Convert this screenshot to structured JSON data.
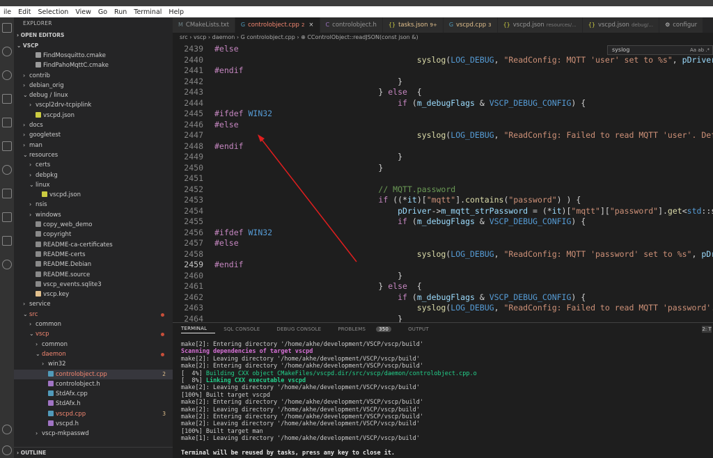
{
  "menu": [
    "ile",
    "Edit",
    "Selection",
    "View",
    "Go",
    "Run",
    "Terminal",
    "Help"
  ],
  "sidebar": {
    "title": "EXPLORER",
    "open_editors": "OPEN EDITORS",
    "root": "VSCP",
    "outline": "OUTLINE",
    "items": [
      {
        "label": "FindMosquitto.cmake",
        "indent": 2,
        "icon": "cmake-file-icon",
        "chev": ""
      },
      {
        "label": "FindPahoMqttC.cmake",
        "indent": 2,
        "icon": "cmake-file-icon",
        "chev": ""
      },
      {
        "label": "contrib",
        "indent": 1,
        "chev": "›"
      },
      {
        "label": "debian_orig",
        "indent": 1,
        "chev": "›"
      },
      {
        "label": "debug / linux",
        "indent": 1,
        "chev": "⌄"
      },
      {
        "label": "vscpl2drv-tcpiplink",
        "indent": 2,
        "chev": "›"
      },
      {
        "label": "vscpd.json",
        "indent": 2,
        "icon": "json-file-icon",
        "chev": ""
      },
      {
        "label": "docs",
        "indent": 1,
        "chev": "›"
      },
      {
        "label": "googletest",
        "indent": 1,
        "chev": "›"
      },
      {
        "label": "man",
        "indent": 1,
        "chev": "›"
      },
      {
        "label": "resources",
        "indent": 1,
        "chev": "⌄"
      },
      {
        "label": "certs",
        "indent": 2,
        "chev": "›"
      },
      {
        "label": "debpkg",
        "indent": 2,
        "chev": "›"
      },
      {
        "label": "linux",
        "indent": 2,
        "chev": "⌄"
      },
      {
        "label": "vscpd.json",
        "indent": 3,
        "icon": "json-file-icon",
        "chev": ""
      },
      {
        "label": "nsis",
        "indent": 2,
        "chev": "›"
      },
      {
        "label": "windows",
        "indent": 2,
        "chev": "›"
      },
      {
        "label": "copy_web_demo",
        "indent": 2,
        "icon": "file-icon",
        "chev": ""
      },
      {
        "label": "copyright",
        "indent": 2,
        "icon": "file-icon",
        "chev": ""
      },
      {
        "label": "README-ca-certificates",
        "indent": 2,
        "icon": "file-icon",
        "chev": ""
      },
      {
        "label": "README-certs",
        "indent": 2,
        "icon": "file-icon",
        "chev": ""
      },
      {
        "label": "README.Debian",
        "indent": 2,
        "icon": "file-icon",
        "chev": ""
      },
      {
        "label": "README.source",
        "indent": 2,
        "icon": "file-icon",
        "chev": ""
      },
      {
        "label": "vscp_events.sqlite3",
        "indent": 2,
        "icon": "file-icon",
        "chev": ""
      },
      {
        "label": "vscp.key",
        "indent": 2,
        "icon": "key-file-icon",
        "chev": ""
      },
      {
        "label": "service",
        "indent": 1,
        "chev": "›"
      },
      {
        "label": "src",
        "indent": 1,
        "chev": "⌄",
        "cls": "err",
        "dot": true
      },
      {
        "label": "common",
        "indent": 2,
        "chev": "›"
      },
      {
        "label": "vscp",
        "indent": 2,
        "chev": "⌄",
        "cls": "err",
        "dot": true
      },
      {
        "label": "common",
        "indent": 3,
        "chev": "›"
      },
      {
        "label": "daemon",
        "indent": 3,
        "chev": "⌄",
        "cls": "err",
        "dot": true
      },
      {
        "label": "win32",
        "indent": 4,
        "chev": "›"
      },
      {
        "label": "controlobject.cpp",
        "indent": 4,
        "icon": "cpp-file-icon",
        "chev": "",
        "cls": "err",
        "badge": "2",
        "active": true
      },
      {
        "label": "controlobject.h",
        "indent": 4,
        "icon": "c-header-file-icon",
        "chev": ""
      },
      {
        "label": "StdAfx.cpp",
        "indent": 4,
        "icon": "cpp-file-icon",
        "chev": ""
      },
      {
        "label": "StdAfx.h",
        "indent": 4,
        "icon": "c-header-file-icon",
        "chev": ""
      },
      {
        "label": "vscpd.cpp",
        "indent": 4,
        "icon": "cpp-file-icon",
        "chev": "",
        "cls": "err",
        "badge": "3"
      },
      {
        "label": "vscpd.h",
        "indent": 4,
        "icon": "c-header-file-icon",
        "chev": ""
      },
      {
        "label": "vscp-mkpasswd",
        "indent": 3,
        "chev": "›"
      }
    ]
  },
  "tabs": [
    {
      "label": "CMakeLists.txt",
      "icon": "M",
      "badge": ""
    },
    {
      "label": "controlobject.cpp",
      "icon": "G",
      "badge": "2",
      "active": true,
      "close": "×"
    },
    {
      "label": "controlobject.h",
      "icon": "C",
      "badge": ""
    },
    {
      "label": "tasks.json",
      "icon": "{}",
      "badge": "9+"
    },
    {
      "label": "vscpd.cpp",
      "icon": "G",
      "badge": "3"
    },
    {
      "label": "vscpd.json",
      "icon": "{}",
      "sub": "resources/..."
    },
    {
      "label": "vscpd.json",
      "icon": "{}",
      "sub": "debug/..."
    },
    {
      "label": "configur",
      "icon": "⚙",
      "sub": ""
    }
  ],
  "breadcrumb": "src  ›  vscp  ›  daemon  ›  G controlobject.cpp  ›  ⊕ CControlObject::readJSON(const json &)",
  "find": {
    "query": "syslog",
    "options": "Aa ab .*"
  },
  "editor": {
    "current_line": "2459",
    "lines": [
      {
        "n": "2439",
        "segs": [
          {
            "t": "#else",
            "c": "pp"
          }
        ]
      },
      {
        "n": "2440",
        "segs": [
          {
            "t": "                                          "
          },
          {
            "t": "syslog",
            "c": "fn"
          },
          {
            "t": "("
          },
          {
            "t": "LOG_DEBUG",
            "c": "mac"
          },
          {
            "t": ", "
          },
          {
            "t": "\"ReadConfig: MQTT 'user' set to %s\"",
            "c": "str"
          },
          {
            "t": ", "
          },
          {
            "t": "pDriver",
            "c": "var"
          }
        ]
      },
      {
        "n": "2441",
        "segs": [
          {
            "t": "#endif",
            "c": "pp"
          }
        ]
      },
      {
        "n": "2442",
        "segs": [
          {
            "t": "                                      }"
          }
        ]
      },
      {
        "n": "2443",
        "segs": [
          {
            "t": "                                  } "
          },
          {
            "t": "else",
            "c": "kw"
          },
          {
            "t": "  {"
          }
        ]
      },
      {
        "n": "2444",
        "segs": [
          {
            "t": "                                      "
          },
          {
            "t": "if",
            "c": "kw"
          },
          {
            "t": " ("
          },
          {
            "t": "m_debugFlags",
            "c": "var"
          },
          {
            "t": " & "
          },
          {
            "t": "VSCP_DEBUG_CONFIG",
            "c": "mac"
          },
          {
            "t": ") {"
          }
        ]
      },
      {
        "n": "2445",
        "segs": [
          {
            "t": "#ifdef ",
            "c": "pp"
          },
          {
            "t": "WIN32",
            "c": "mac"
          }
        ]
      },
      {
        "n": "2446",
        "segs": [
          {
            "t": "#else",
            "c": "pp"
          }
        ]
      },
      {
        "n": "2447",
        "segs": [
          {
            "t": "                                          "
          },
          {
            "t": "syslog",
            "c": "fn"
          },
          {
            "t": "("
          },
          {
            "t": "LOG_DEBUG",
            "c": "mac"
          },
          {
            "t": ", "
          },
          {
            "t": "\"ReadConfig: Failed to read MQTT 'user'. Def",
            "c": "str"
          }
        ]
      },
      {
        "n": "2448",
        "segs": [
          {
            "t": "#endif",
            "c": "pp"
          }
        ]
      },
      {
        "n": "2449",
        "segs": [
          {
            "t": "                                      }"
          }
        ]
      },
      {
        "n": "2450",
        "segs": [
          {
            "t": "                                  }"
          }
        ]
      },
      {
        "n": "2451",
        "segs": [
          {
            "t": ""
          }
        ]
      },
      {
        "n": "2452",
        "segs": [
          {
            "t": "                                  "
          },
          {
            "t": "// MQTT.password",
            "c": "cmt"
          }
        ]
      },
      {
        "n": "2453",
        "segs": [
          {
            "t": "                                  "
          },
          {
            "t": "if",
            "c": "kw"
          },
          {
            "t": " ((*"
          },
          {
            "t": "it",
            "c": "var"
          },
          {
            "t": ")["
          },
          {
            "t": "\"mqtt\"",
            "c": "str"
          },
          {
            "t": "]."
          },
          {
            "t": "contains",
            "c": "fn"
          },
          {
            "t": "("
          },
          {
            "t": "\"password\"",
            "c": "str"
          },
          {
            "t": ") ) {"
          }
        ]
      },
      {
        "n": "2454",
        "segs": [
          {
            "t": "                                      "
          },
          {
            "t": "pDriver",
            "c": "var"
          },
          {
            "t": "->"
          },
          {
            "t": "m_mqtt_strPassword",
            "c": "var"
          },
          {
            "t": " = (*"
          },
          {
            "t": "it",
            "c": "var"
          },
          {
            "t": ")["
          },
          {
            "t": "\"mqtt\"",
            "c": "str"
          },
          {
            "t": "]["
          },
          {
            "t": "\"password\"",
            "c": "str"
          },
          {
            "t": "]."
          },
          {
            "t": "get",
            "c": "fn"
          },
          {
            "t": "<"
          },
          {
            "t": "std",
            "c": "mac"
          },
          {
            "t": "::s"
          }
        ]
      },
      {
        "n": "2455",
        "segs": [
          {
            "t": "                                      "
          },
          {
            "t": "if",
            "c": "kw"
          },
          {
            "t": " ("
          },
          {
            "t": "m_debugFlags",
            "c": "var"
          },
          {
            "t": " & "
          },
          {
            "t": "VSCP_DEBUG_CONFIG",
            "c": "mac"
          },
          {
            "t": ") {"
          }
        ]
      },
      {
        "n": "2456",
        "segs": [
          {
            "t": "#ifdef ",
            "c": "pp"
          },
          {
            "t": "WIN32",
            "c": "mac"
          }
        ]
      },
      {
        "n": "2457",
        "segs": [
          {
            "t": "#else",
            "c": "pp"
          }
        ]
      },
      {
        "n": "2458",
        "segs": [
          {
            "t": "                                          "
          },
          {
            "t": "syslog",
            "c": "fn"
          },
          {
            "t": "("
          },
          {
            "t": "LOG_DEBUG",
            "c": "mac"
          },
          {
            "t": ", "
          },
          {
            "t": "\"ReadConfig: MQTT 'password' set to %s\"",
            "c": "str"
          },
          {
            "t": ", "
          },
          {
            "t": "pDr",
            "c": "var"
          }
        ]
      },
      {
        "n": "2459",
        "segs": [
          {
            "t": "#endif",
            "c": "pp"
          }
        ]
      },
      {
        "n": "2460",
        "segs": [
          {
            "t": "                                      }"
          }
        ]
      },
      {
        "n": "2461",
        "segs": [
          {
            "t": "                                  } "
          },
          {
            "t": "else",
            "c": "kw"
          },
          {
            "t": "  {"
          }
        ]
      },
      {
        "n": "2462",
        "segs": [
          {
            "t": "                                      "
          },
          {
            "t": "if",
            "c": "kw"
          },
          {
            "t": " ("
          },
          {
            "t": "m_debugFlags",
            "c": "var"
          },
          {
            "t": " & "
          },
          {
            "t": "VSCP_DEBUG_CONFIG",
            "c": "mac"
          },
          {
            "t": ") {"
          }
        ]
      },
      {
        "n": "2463",
        "segs": [
          {
            "t": "                                          "
          },
          {
            "t": "syslog",
            "c": "fn"
          },
          {
            "t": "("
          },
          {
            "t": "LOG_DEBUG",
            "c": "mac"
          },
          {
            "t": ", "
          },
          {
            "t": "\"ReadConfig: Failed to read MQTT 'password'.",
            "c": "str"
          }
        ]
      },
      {
        "n": "2464",
        "segs": [
          {
            "t": "                                      }"
          }
        ]
      }
    ]
  },
  "panel": {
    "tabs": [
      "TERMINAL",
      "SQL CONSOLE",
      "DEBUG CONSOLE",
      "PROBLEMS",
      "OUTPUT"
    ],
    "problems_count": "350",
    "right_label": "2: T",
    "lines": [
      {
        "t": "make[2]: Entering directory '/home/akhe/development/VSCP/vscp/build'"
      },
      {
        "t": "Scanning dependencies of target vscpd",
        "c": "t-magenta"
      },
      {
        "t": "make[2]: Leaving directory '/home/akhe/development/VSCP/vscp/build'"
      },
      {
        "t": "make[2]: Entering directory '/home/akhe/development/VSCP/vscp/build'"
      },
      {
        "t": "[  4%] ",
        "t2": "Building CXX object CMakeFiles/vscpd.dir/src/vscp/daemon/controlobject.cpp.o",
        "c2": "t-green"
      },
      {
        "t": "[  8%] ",
        "t2": "Linking CXX executable vscpd",
        "c2": "t-greenb"
      },
      {
        "t": "make[2]: Leaving directory '/home/akhe/development/VSCP/vscp/build'"
      },
      {
        "t": "[100%] Built target vscpd"
      },
      {
        "t": "make[2]: Entering directory '/home/akhe/development/VSCP/vscp/build'"
      },
      {
        "t": "make[2]: Leaving directory '/home/akhe/development/VSCP/vscp/build'"
      },
      {
        "t": "make[2]: Entering directory '/home/akhe/development/VSCP/vscp/build'"
      },
      {
        "t": "make[2]: Leaving directory '/home/akhe/development/VSCP/vscp/build'"
      },
      {
        "t": "[100%] Built target man"
      },
      {
        "t": "make[1]: Leaving directory '/home/akhe/development/VSCP/vscp/build'"
      },
      {
        "t": ""
      },
      {
        "t": "Terminal will be reused by tasks, press any key to close it.",
        "c": "t-bold"
      }
    ]
  },
  "colors": {
    "accent_error": "#f48771",
    "annotation_arrow": "#e01e1e"
  }
}
